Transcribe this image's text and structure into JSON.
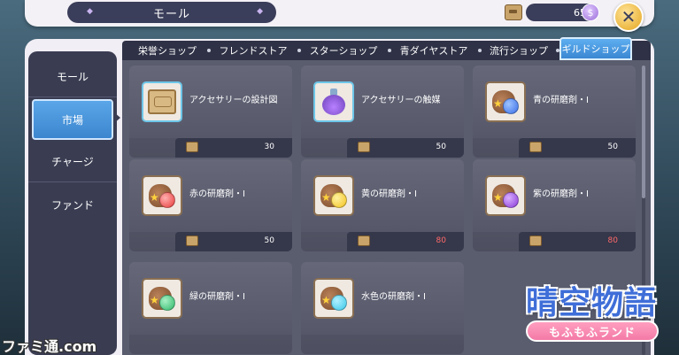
{
  "header": {
    "title": "モール",
    "currency_amount": "65",
    "plus_label": "$",
    "close_label": "✕"
  },
  "sidebar": {
    "items": [
      {
        "label": "モール"
      },
      {
        "label": "市場"
      },
      {
        "label": "チャージ"
      },
      {
        "label": "ファンド"
      }
    ]
  },
  "tabs": [
    {
      "label": "栄誉ショップ"
    },
    {
      "label": "フレンドストア"
    },
    {
      "label": "スターショップ"
    },
    {
      "label": "青ダイヤストア"
    },
    {
      "label": "流行ショップ"
    },
    {
      "label": "ギルドショップ"
    }
  ],
  "items": [
    {
      "name": "アクセサリーの設計図",
      "price": "30",
      "icon": "blueprint-scroll-icon",
      "price_color": "white"
    },
    {
      "name": "アクセサリーの触媒",
      "price": "50",
      "icon": "catalyst-bottle-icon",
      "price_color": "white"
    },
    {
      "name": "青の研磨剤・I",
      "price": "50",
      "icon": "blue-polish-bag-icon",
      "gem_color": "#3a6ee8",
      "price_color": "white"
    },
    {
      "name": "赤の研磨剤・I",
      "price": "50",
      "icon": "red-polish-bag-icon",
      "gem_color": "#e83a3a",
      "price_color": "white"
    },
    {
      "name": "黄の研磨剤・I",
      "price": "80",
      "icon": "yellow-polish-bag-icon",
      "gem_color": "#f2c21c",
      "price_color": "red"
    },
    {
      "name": "紫の研磨剤・I",
      "price": "80",
      "icon": "purple-polish-bag-icon",
      "gem_color": "#8a3ad8",
      "price_color": "red"
    },
    {
      "name": "緑の研磨剤・I",
      "price": "",
      "icon": "green-polish-bag-icon",
      "gem_color": "#2fb86a",
      "price_color": "white"
    },
    {
      "name": "水色の研磨剤・I",
      "price": "",
      "icon": "lightblue-polish-bag-icon",
      "gem_color": "#3ac8e8",
      "price_color": "white"
    }
  ],
  "logo": {
    "main": "晴空物語",
    "sub": "もふもふランド"
  },
  "watermark": "ファミ通.com"
}
